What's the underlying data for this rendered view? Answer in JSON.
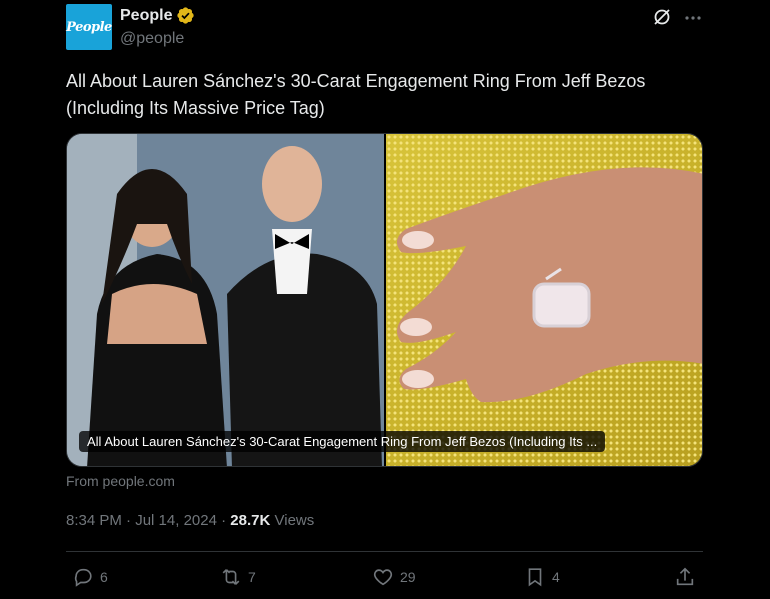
{
  "account": {
    "avatar_text": "People",
    "display_name": "People",
    "handle": "@people",
    "verified_color": "#e2b719"
  },
  "tweet": {
    "text": "All About Lauren Sánchez's 30-Carat Engagement Ring From Jeff Bezos (Including Its Massive Price Tag)"
  },
  "card": {
    "caption": "All About Lauren Sánchez's 30-Carat Engagement Ring From Jeff Bezos (Including Its ...",
    "source": "From people.com"
  },
  "meta": {
    "time": "8:34 PM",
    "separator": "·",
    "date": "Jul 14, 2024",
    "views_count": "28.7K",
    "views_label": "Views"
  },
  "actions": {
    "replies": "6",
    "reposts": "7",
    "likes": "29",
    "bookmarks": "4"
  },
  "icons": {
    "header_right": [
      "grok-icon",
      "more-icon"
    ],
    "action_bar": [
      "reply-icon",
      "repost-icon",
      "like-icon",
      "bookmark-icon",
      "share-icon"
    ]
  }
}
